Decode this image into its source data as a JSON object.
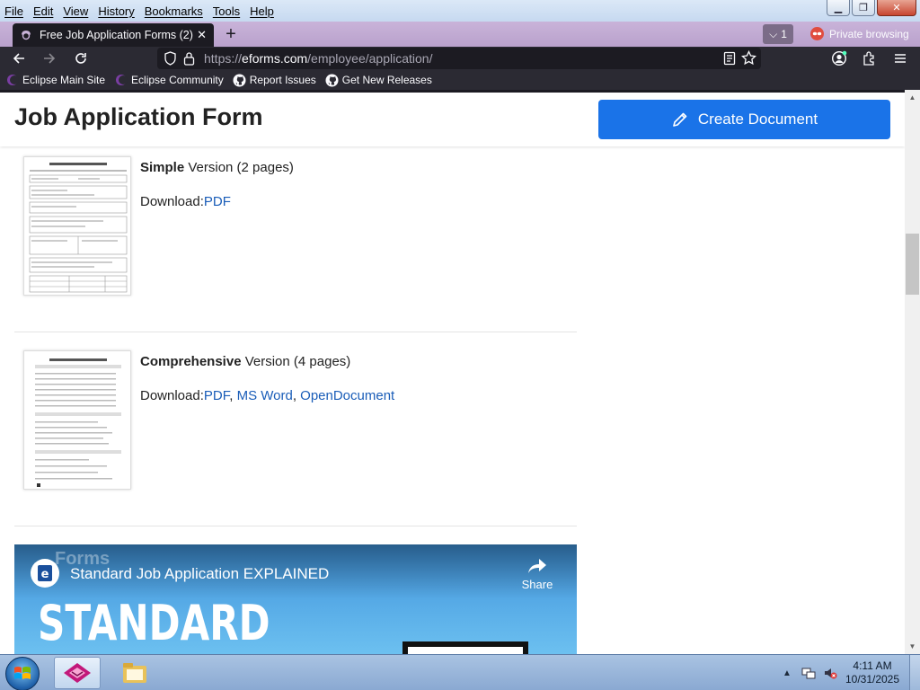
{
  "menubar": {
    "items": [
      "File",
      "Edit",
      "View",
      "History",
      "Bookmarks",
      "Tools",
      "Help"
    ]
  },
  "tabs": {
    "active_title": "Free Job Application Forms (2) -",
    "tab_count": "1",
    "private_label": "Private browsing"
  },
  "navbar": {
    "url_prefix": "https://",
    "url_host": "eforms.com",
    "url_path": "/employee/application/"
  },
  "bookmarks": {
    "items": [
      "Eclipse Main Site",
      "Eclipse Community",
      "Report Issues",
      "Get New Releases"
    ]
  },
  "page": {
    "title": "Job Application Form",
    "create_button": "Create Document",
    "versions": [
      {
        "name": "Simple",
        "suffix": " Version (2 pages)",
        "download_label": "Download:",
        "links": [
          "PDF"
        ]
      },
      {
        "name": "Comprehensive",
        "suffix": " Version (4 pages)",
        "download_label": "Download:",
        "links": [
          "PDF",
          "MS Word",
          "OpenDocument"
        ]
      }
    ],
    "video": {
      "title": "Standard Job Application EXPLAINED",
      "share_label": "Share",
      "banner_text": "STANDARD",
      "watermark": "Forms"
    }
  },
  "taskbar": {
    "time": "4:11 AM",
    "date": "10/31/2025"
  },
  "colors": {
    "accent_blue": "#1a73e8",
    "link_blue": "#1a5db8",
    "firefox_dark": "#2b2a33",
    "private_purple": "#b9a1cc"
  }
}
